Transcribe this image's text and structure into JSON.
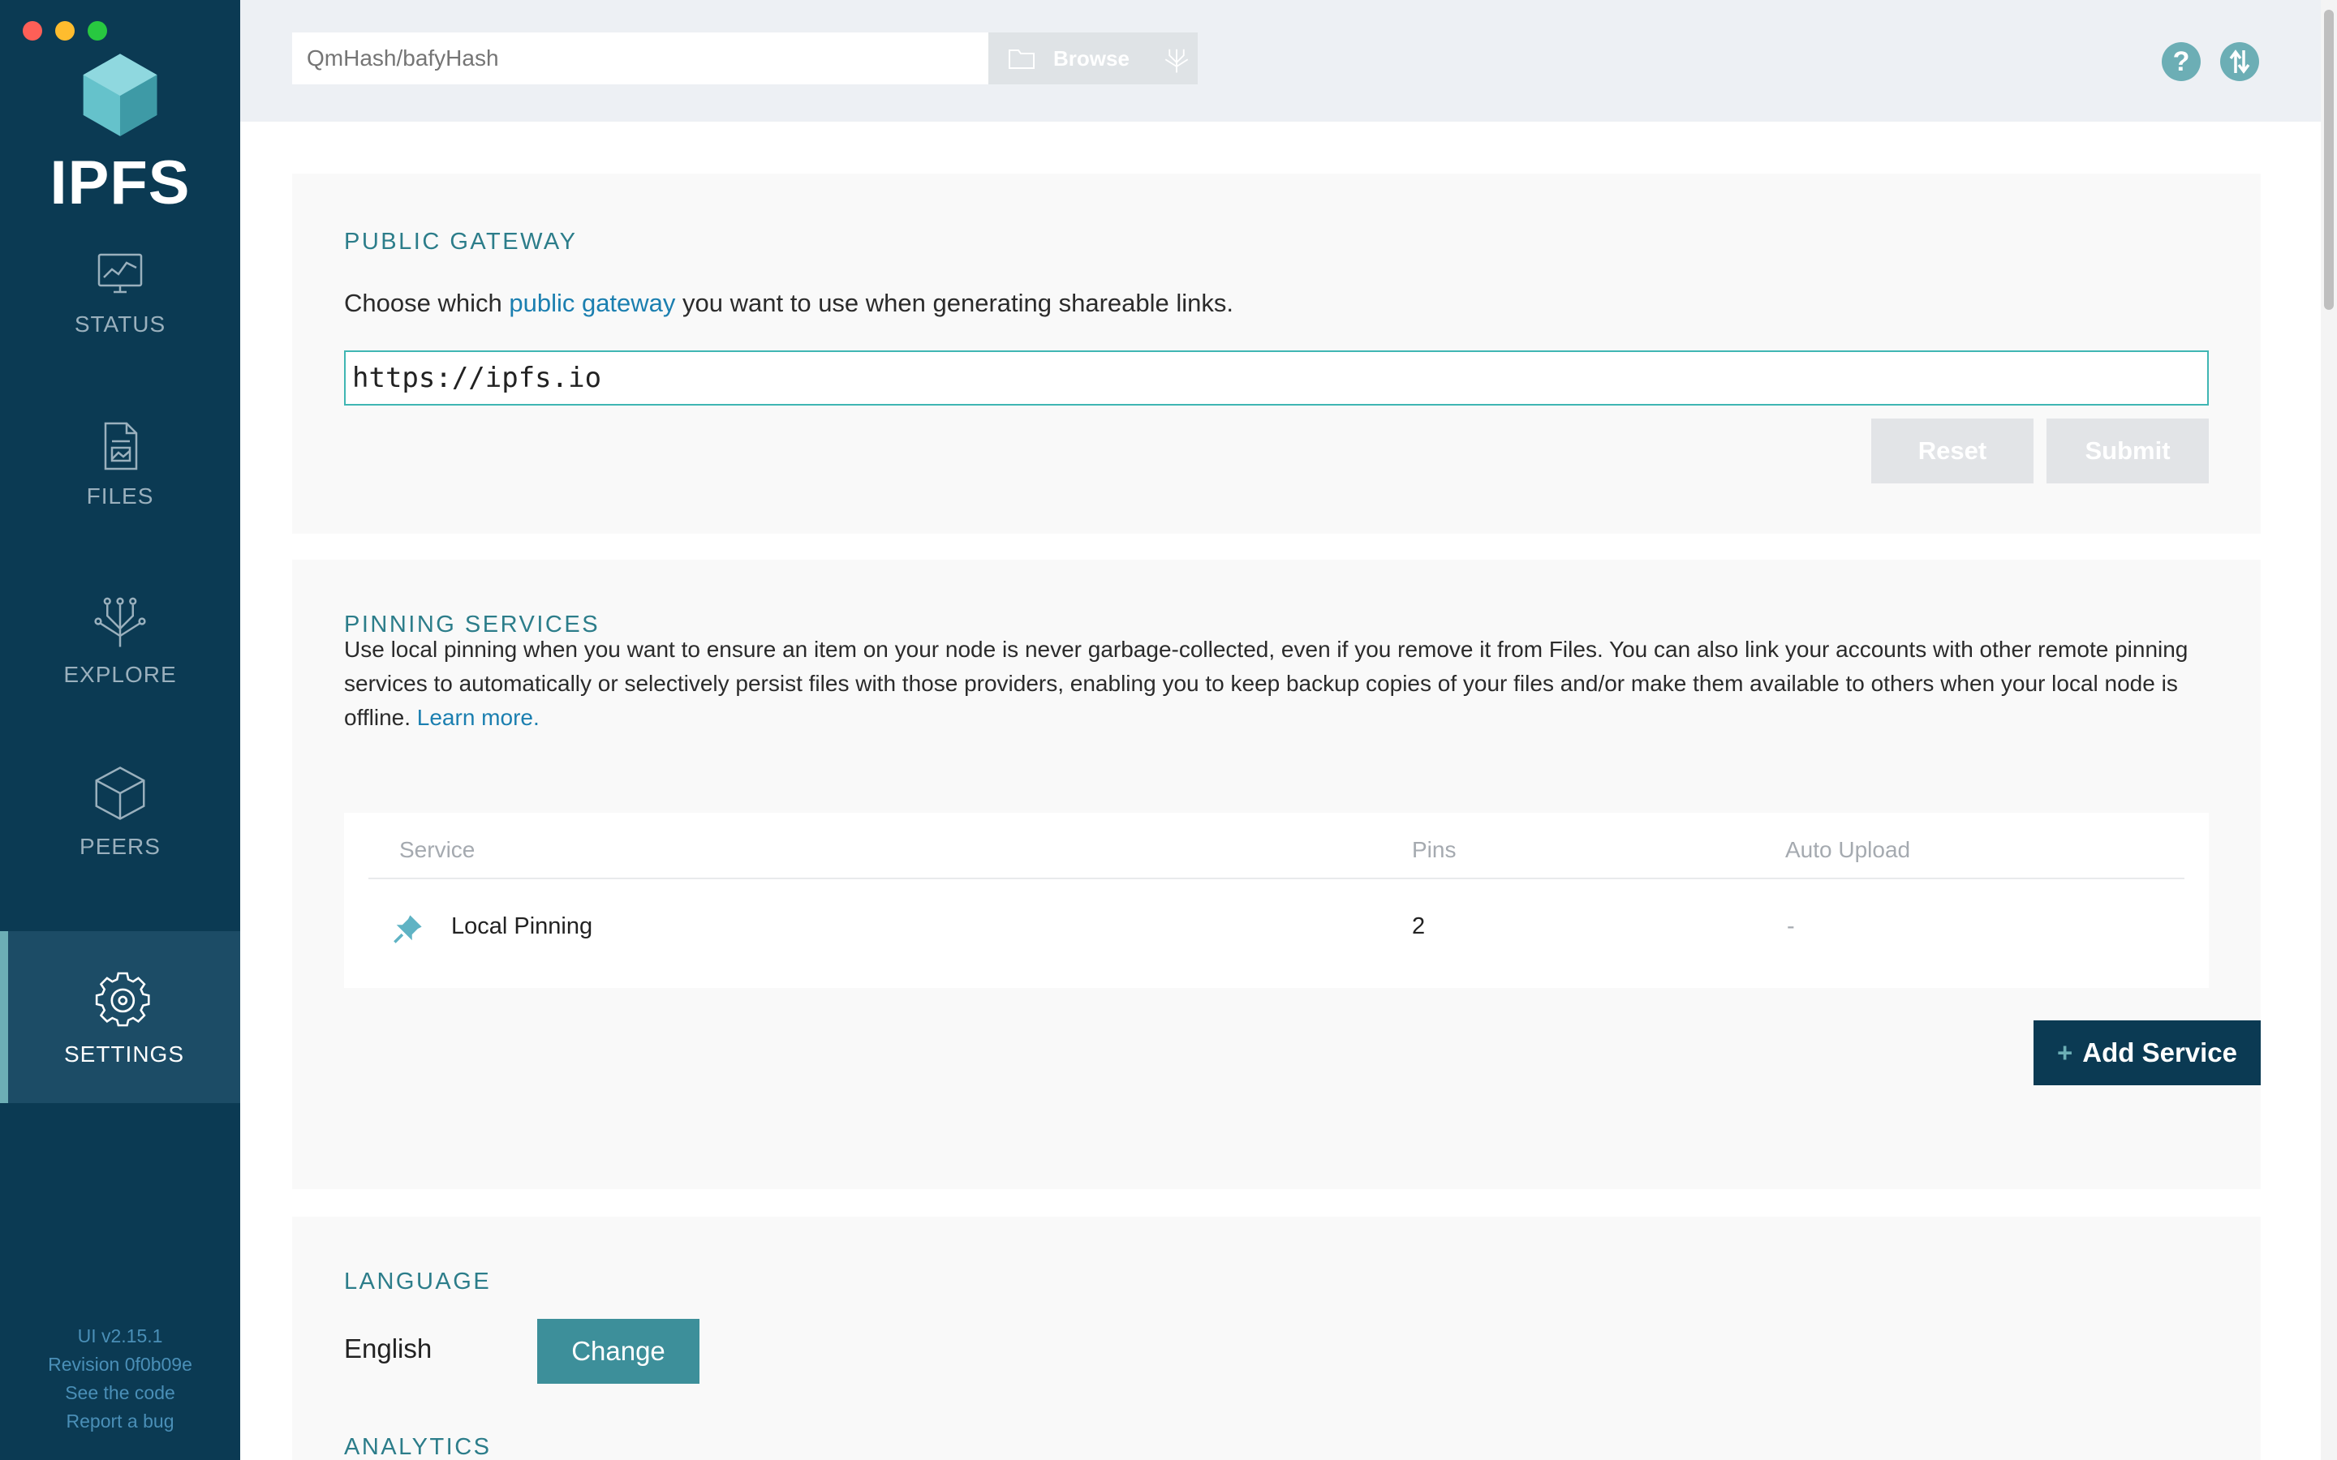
{
  "app": {
    "logo_text": "IPFS"
  },
  "sidebar": {
    "items": [
      {
        "label": "STATUS",
        "icon": "status-monitor-icon"
      },
      {
        "label": "FILES",
        "icon": "files-document-icon"
      },
      {
        "label": "EXPLORE",
        "icon": "explore-tree-icon"
      },
      {
        "label": "PEERS",
        "icon": "peers-cube-icon"
      },
      {
        "label": "SETTINGS",
        "icon": "gear-icon",
        "active": true
      }
    ],
    "footer": {
      "version": "UI v2.15.1",
      "revision": "Revision 0f0b09e",
      "see_code": "See the code",
      "report_bug": "Report a bug"
    }
  },
  "topbar": {
    "search_placeholder": "QmHash/bafyHash",
    "browse_label": "Browse",
    "help_icon": "help-icon",
    "connection_icon": "transfer-icon"
  },
  "public_gateway": {
    "title": "PUBLIC GATEWAY",
    "desc_before": "Choose which ",
    "desc_link": "public gateway",
    "desc_after": " you want to use when generating shareable links.",
    "value": "https://ipfs.io",
    "reset_label": "Reset",
    "submit_label": "Submit"
  },
  "pinning": {
    "title": "PINNING SERVICES",
    "description": "Use local pinning when you want to ensure an item on your node is never garbage-collected, even if you remove it from Files. You can also link your accounts with other remote pinning services to automatically or selectively persist files with those providers, enabling you to keep backup copies of your files and/or make them available to others when your local node is offline.",
    "learn_more": "Learn more.",
    "columns": {
      "service": "Service",
      "pins": "Pins",
      "auto_upload": "Auto Upload"
    },
    "rows": [
      {
        "service": "Local Pinning",
        "pins": "2",
        "auto_upload": "-",
        "icon": "pin-icon"
      }
    ],
    "add_service_plus": "+",
    "add_service_label": "Add Service"
  },
  "language": {
    "title": "LANGUAGE",
    "current": "English",
    "change_label": "Change"
  },
  "analytics": {
    "title": "ANALYTICS"
  },
  "colors": {
    "sidebar_bg": "#0b3a53",
    "accent_teal": "#6caeb5",
    "section_title": "#2c7d8a",
    "link": "#1b7fb0"
  }
}
